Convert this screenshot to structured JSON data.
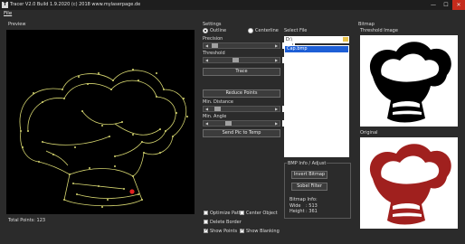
{
  "window": {
    "title": "Tracer V2.0 Build 1.9.2020 (c) 2018 www.mylaserpage.de",
    "icon_letter": "T",
    "min": "—",
    "max": "☐",
    "close": "✕"
  },
  "menu": {
    "file": "File"
  },
  "preview": {
    "label": "Preview",
    "total_points": "Total Points: 123"
  },
  "settings": {
    "label": "Settings",
    "outline": "Outline",
    "centerline": "Centerline",
    "precision_label": "Precision",
    "precision_value": "1",
    "threshold_label": "Threshold",
    "threshold_value": "85",
    "trace_button": "Trace",
    "reduce_button": "Reduce Points",
    "min_distance_label": "Min. Distance",
    "min_distance_value": "2",
    "min_angle_label": "Min. Angle",
    "min_angle_value": "30",
    "send_button": "Send Pic to Temp",
    "optimize_path": "Optimize Path",
    "center_object": "Center Object",
    "delete_border": "Delete Border",
    "show_points": "Show Points",
    "show_blanking": "Show Blanking"
  },
  "file": {
    "label": "Select File",
    "path": "D:\\",
    "selected_file": "Cap.bmp"
  },
  "bmp": {
    "label": "BMP Info / Adjust",
    "invert_button": "Invert Bitmap",
    "sobel_button": "Sobel Filter",
    "info_label": "Bitmap Info:",
    "width_label": "Wide",
    "width_value": ": 513",
    "height_label": "Height",
    "height_value": ": 361"
  },
  "bitmap": {
    "label": "Bitmap",
    "threshold_label": "Threshold Image",
    "original_label": "Original"
  },
  "colors": {
    "trace": "#d6d670",
    "marker": "#e02020",
    "original_fill": "#a0201e"
  }
}
